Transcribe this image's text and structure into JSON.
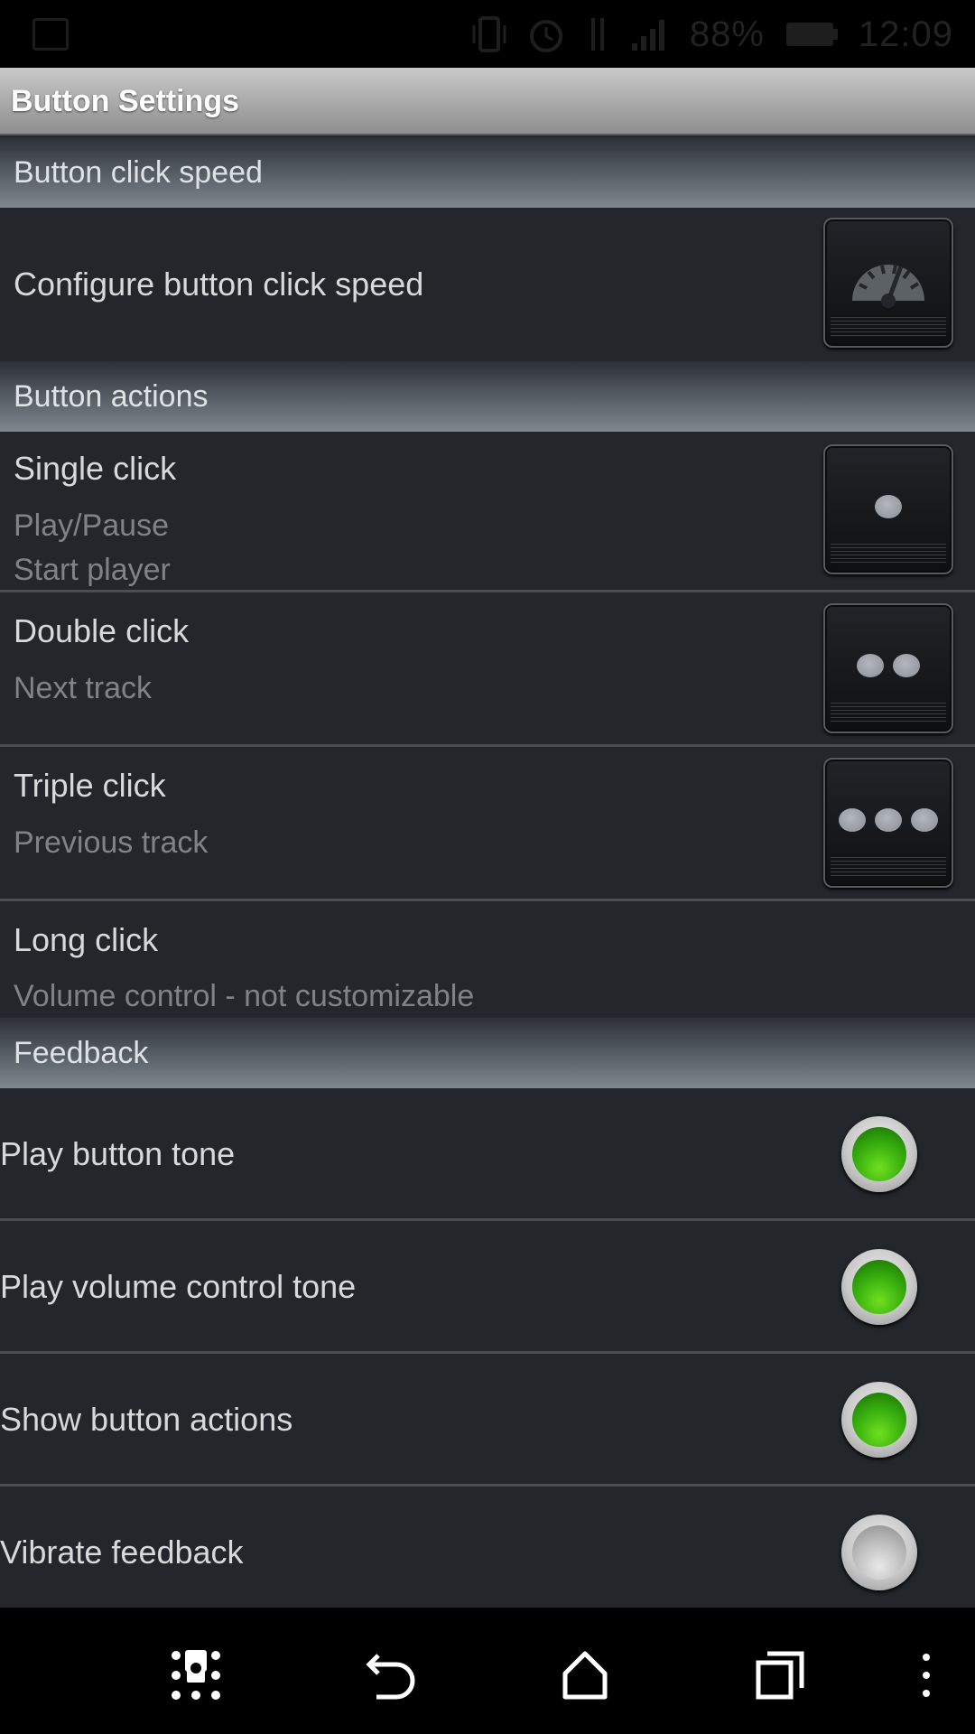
{
  "status_bar": {
    "battery_text": "88%",
    "time": "12:09",
    "icons": [
      "vibrate-icon",
      "alarm-icon",
      "data-icon",
      "signal-icon",
      "battery-icon"
    ]
  },
  "title_bar": {
    "title": "Button Settings"
  },
  "sections": {
    "click_speed": {
      "header": "Button click speed",
      "item_title": "Configure button click speed",
      "icon": "speedometer-icon"
    },
    "actions": {
      "header": "Button actions",
      "items": [
        {
          "title": "Single click",
          "sub": "Play/Pause",
          "sub2": "Start player",
          "dots": 1
        },
        {
          "title": "Double click",
          "sub": "Next track",
          "dots": 2
        },
        {
          "title": "Triple click",
          "sub": "Previous track",
          "dots": 3
        },
        {
          "title": "Long click",
          "sub": "Volume control - not customizable"
        }
      ]
    },
    "feedback": {
      "header": "Feedback",
      "items": [
        {
          "label": "Play button tone",
          "on": true
        },
        {
          "label": "Play volume control tone",
          "on": true
        },
        {
          "label": "Show button actions",
          "on": true
        },
        {
          "label": "Vibrate feedback",
          "on": false
        }
      ]
    }
  },
  "nav_bar": {
    "buttons": [
      "app-drawer-icon",
      "back-icon",
      "home-icon",
      "recents-icon",
      "overflow-menu-icon"
    ]
  },
  "colors": {
    "background": "#23272b",
    "toggle_on": "#32a80c",
    "toggle_off": "#b8b8b8"
  }
}
